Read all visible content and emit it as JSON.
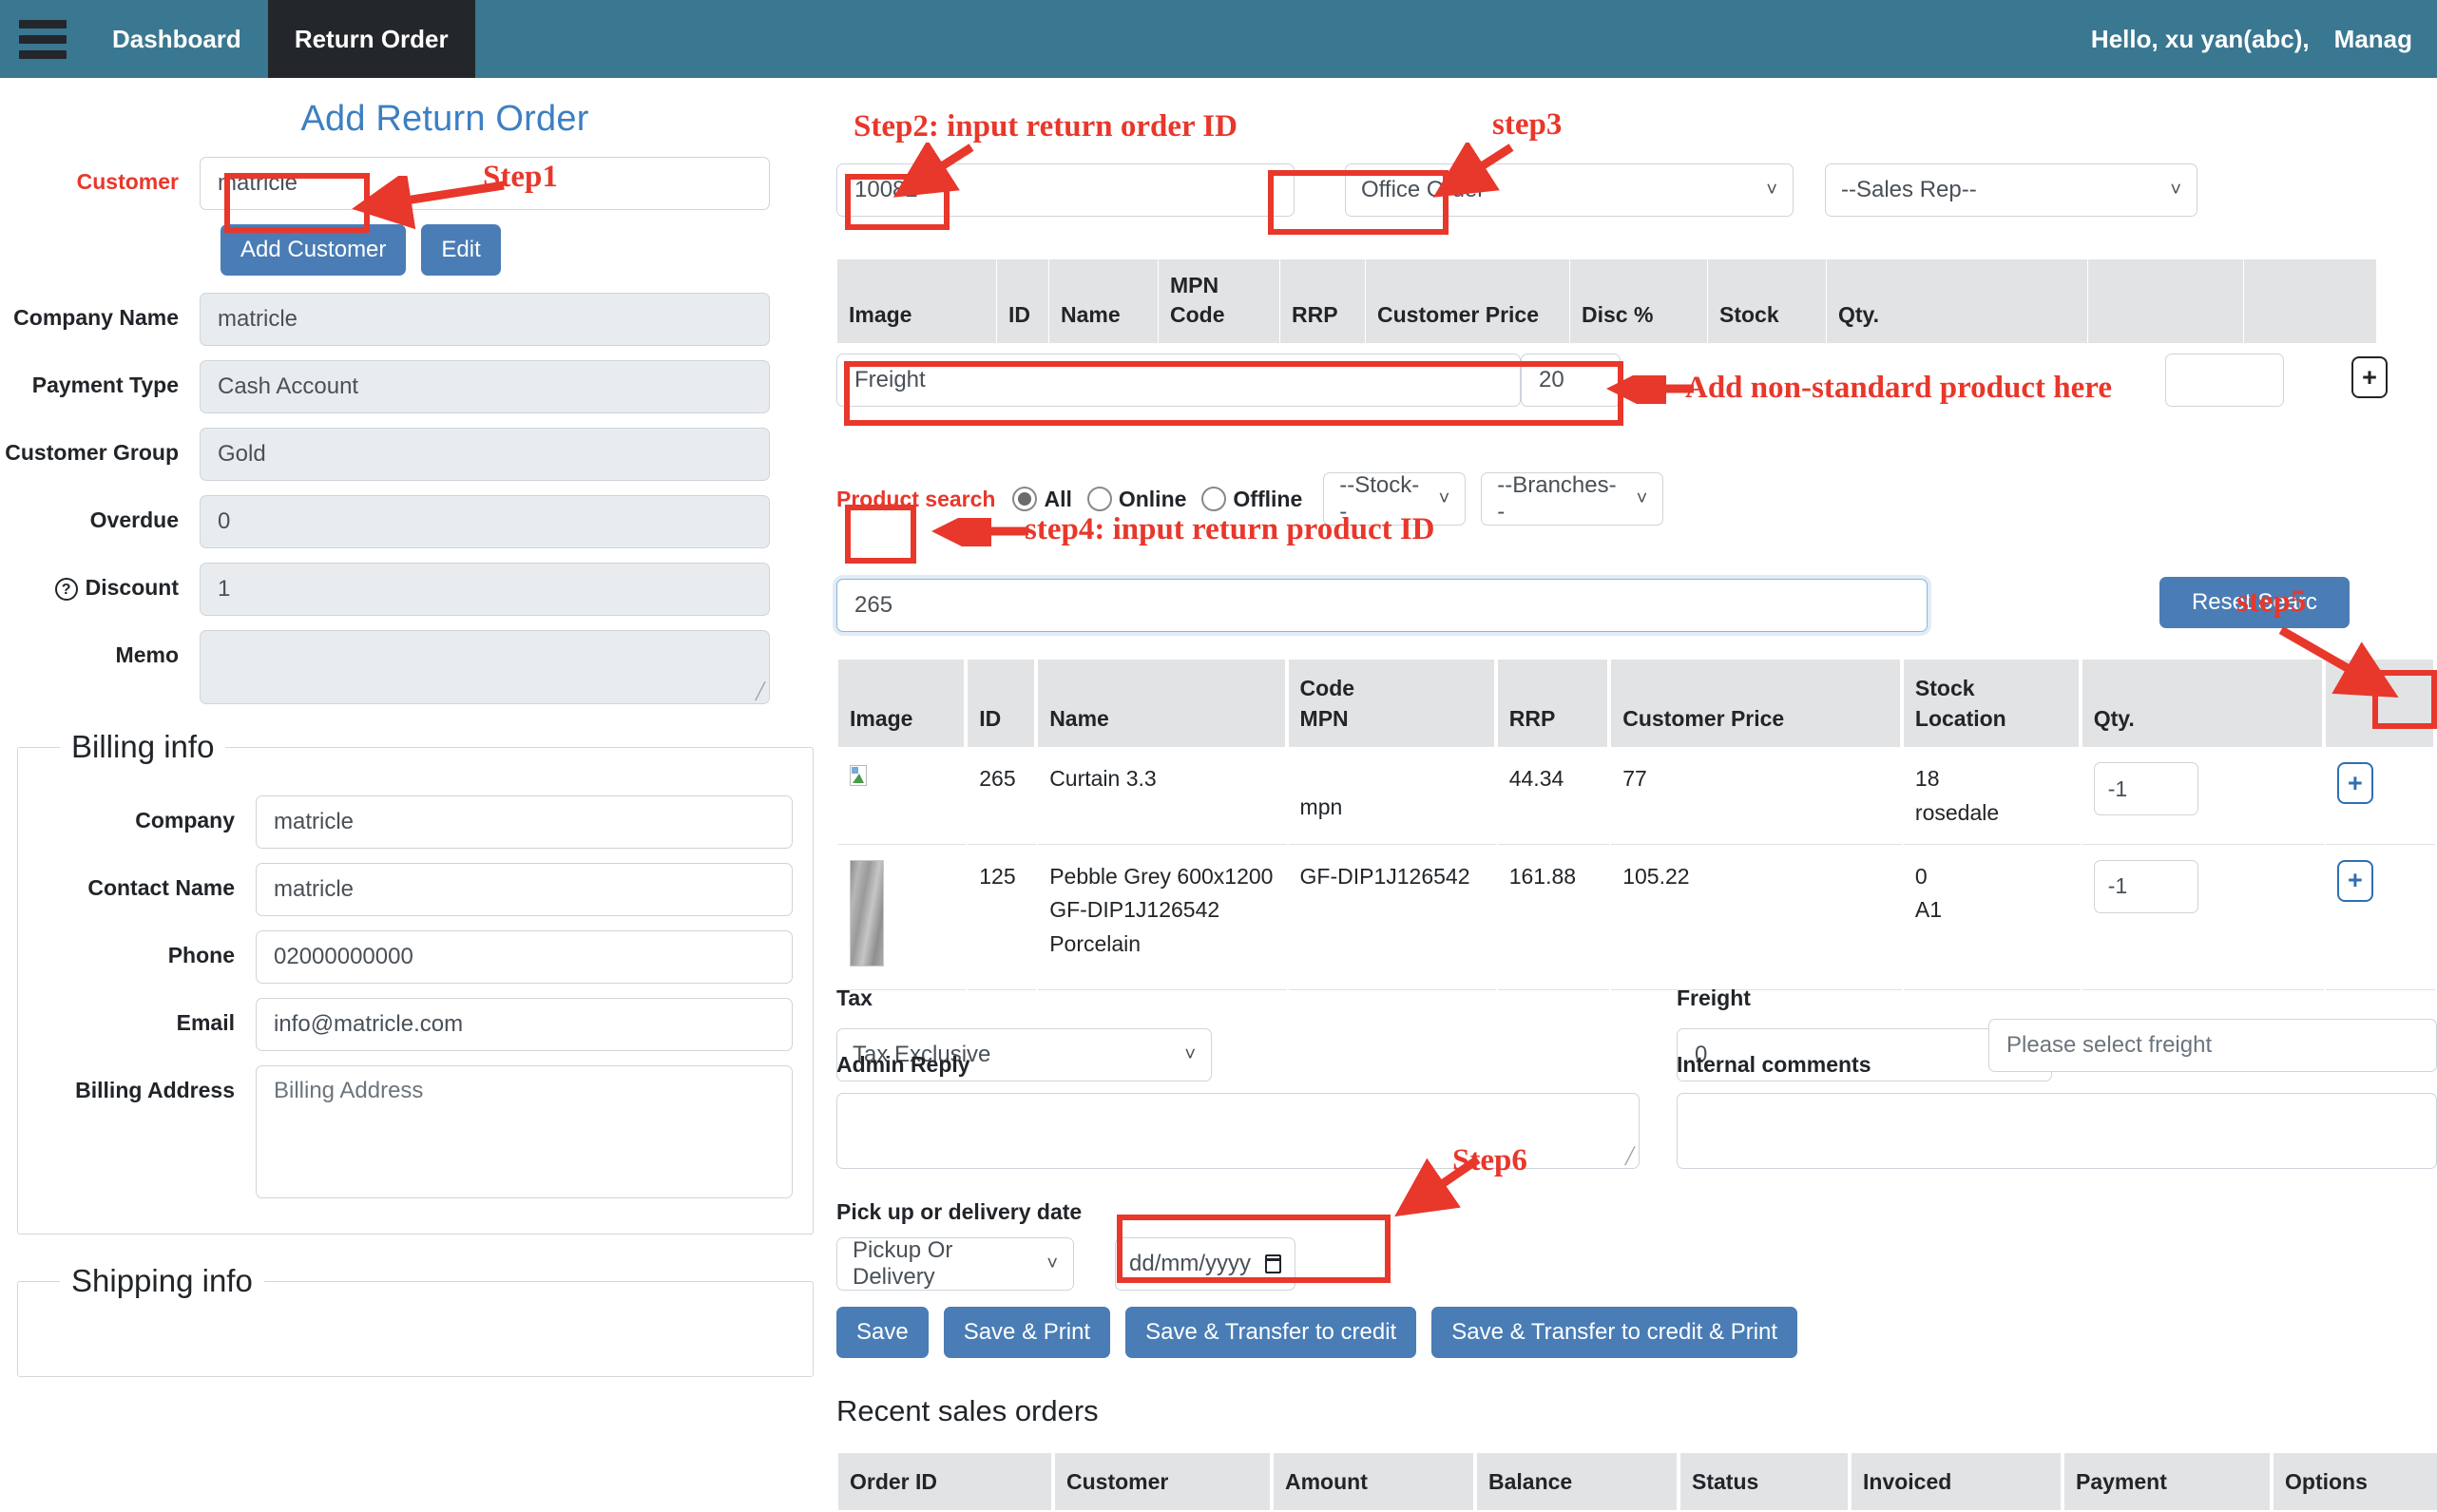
{
  "navbar": {
    "menu_icon": "hamburger-icon",
    "links": [
      {
        "label": "Dashboard",
        "active": false
      },
      {
        "label": "Return Order",
        "active": true
      }
    ],
    "greeting": "Hello, xu yan(abc),",
    "role": "Manag",
    "bg_color": "#3a7791",
    "active_bg_color": "#23272b"
  },
  "left": {
    "page_title": "Add Return Order",
    "customer_label": "Customer",
    "customer_value": "matricle",
    "add_customer_label": "Add Customer",
    "edit_label": "Edit",
    "fields": [
      {
        "label": "Company Name",
        "value": "matricle"
      },
      {
        "label": "Payment Type",
        "value": "Cash Account"
      },
      {
        "label": "Customer Group",
        "value": "Gold"
      },
      {
        "label": "Overdue",
        "value": "0"
      },
      {
        "label": "Discount",
        "value": "1"
      }
    ],
    "memo_label": "Memo",
    "memo_value": "",
    "billing_legend": "Billing info",
    "billing_fields": [
      {
        "label": "Company",
        "value": "matricle",
        "placeholder": ""
      },
      {
        "label": "Contact Name",
        "value": "matricle",
        "placeholder": ""
      },
      {
        "label": "Phone",
        "value": "02000000000",
        "placeholder": ""
      },
      {
        "label": "Email",
        "value": "info@matricle.com",
        "placeholder": ""
      }
    ],
    "billing_address_label": "Billing Address",
    "billing_address_placeholder": "Billing Address",
    "shipping_legend": "Shipping info"
  },
  "right": {
    "order_id_value": "10082",
    "order_type_value": "Office Order",
    "sales_rep_value": "--Sales Rep--",
    "cart_table": {
      "headers": [
        "Image",
        "ID",
        "Name",
        "MPN\nCode",
        "RRP",
        "Customer Price",
        "Disc %",
        "Stock",
        "Qty.",
        "",
        ""
      ],
      "freight_row": {
        "name": "Freight",
        "price": "20",
        "qty": ""
      }
    },
    "product_search": {
      "label": "Product search",
      "options": [
        {
          "label": "All",
          "selected": true
        },
        {
          "label": "Online",
          "selected": false
        },
        {
          "label": "Offline",
          "selected": false
        }
      ],
      "stock_select": "--Stock--",
      "branches_select": "--Branches--",
      "search_value": "265",
      "reset_label": "Reset Searc"
    },
    "result_table": {
      "headers": [
        "Image",
        "ID",
        "Name",
        "Code\nMPN",
        "RRP",
        "Customer Price",
        "Stock\nLocation",
        "Qty.",
        ""
      ],
      "rows": [
        {
          "image": "broken-image-icon",
          "id": "265",
          "name": "Curtain 3.3",
          "code": "",
          "mpn": "mpn",
          "rrp": "44.34",
          "customer_price": "77",
          "stock": "18",
          "location": "rosedale",
          "qty": "-1"
        },
        {
          "image": "product-thumbnail",
          "id": "125",
          "name": "Pebble Grey 600x1200\nGF-DIP1J126542\nPorcelain",
          "code": "GF-DIP1J126542",
          "mpn": "",
          "rrp": "161.88",
          "customer_price": "105.22",
          "stock": "0",
          "location": "A1",
          "qty": "-1"
        }
      ]
    },
    "tax_label": "Tax",
    "tax_value": "Tax Exclusive",
    "freight_label": "Freight",
    "freight_value": "0",
    "freight_select_placeholder": "Please select freight",
    "admin_reply_label": "Admin Reply",
    "admin_reply_value": "",
    "internal_comments_label": "Internal comments",
    "internal_comments_value": "",
    "pickup_label": "Pick up or delivery date",
    "pickup_select": "Pickup Or Delivery",
    "date_placeholder": "dd/mm/yyyy",
    "buttons": [
      "Save",
      "Save & Print",
      "Save & Transfer to credit",
      "Save & Transfer to credit & Print"
    ],
    "recent_title": "Recent sales orders",
    "recent_headers": [
      "Order ID",
      "Customer",
      "Amount",
      "Balance",
      "Status",
      "Invoiced",
      "Payment",
      "Options"
    ]
  },
  "annotations": [
    {
      "id": "step1",
      "text": "Step1"
    },
    {
      "id": "step2",
      "text": "Step2: input return order ID"
    },
    {
      "id": "step3",
      "text": "step3"
    },
    {
      "id": "nonstandard",
      "text": "Add non-standard product here"
    },
    {
      "id": "step4",
      "text": "step4: input return product ID"
    },
    {
      "id": "step5",
      "text": "step5"
    },
    {
      "id": "step6",
      "text": "Step6"
    }
  ],
  "colors": {
    "nav": "#3a7791",
    "accent_blue": "#4a7db5",
    "annotation_red": "#e8372b",
    "title_blue": "#3d7fc1"
  }
}
